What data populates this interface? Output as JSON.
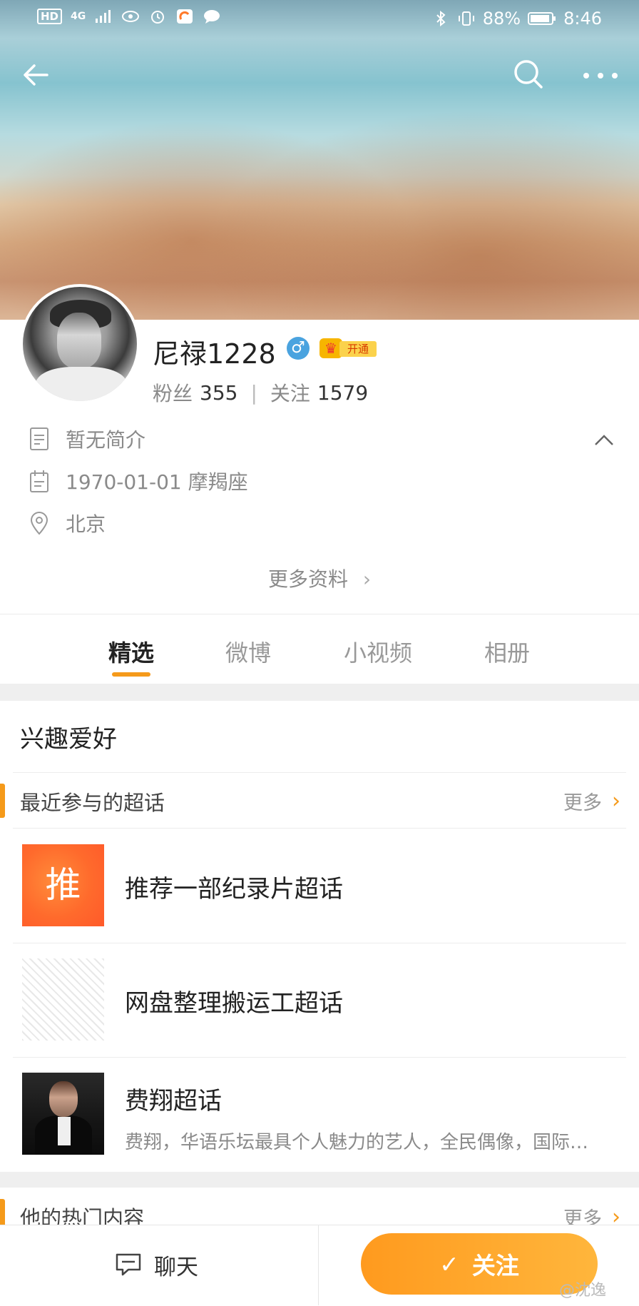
{
  "status_bar": {
    "left": [
      "HD",
      "4G"
    ],
    "battery": "88%",
    "time": "8:46"
  },
  "profile": {
    "name": "尼禄1228",
    "gender_symbol": "♂",
    "vip_tag": "开通",
    "followers_label": "粉丝",
    "followers_count": "355",
    "separator": "|",
    "following_label": "关注",
    "following_count": "1579"
  },
  "info": {
    "bio": "暂无简介",
    "birthday": "1970-01-01 摩羯座",
    "location": "北京",
    "more_label": "更多资料",
    "more_chevron": "›"
  },
  "tabs": [
    {
      "label": "精选",
      "active": true
    },
    {
      "label": "微博",
      "active": false
    },
    {
      "label": "小视频",
      "active": false
    },
    {
      "label": "相册",
      "active": false
    }
  ],
  "interests": {
    "title": "兴趣爱好",
    "recent_topics_label": "最近参与的超话",
    "more_label": "更多",
    "chevron": "›",
    "topics": [
      {
        "thumb_text": "推",
        "name": "推荐一部纪录片超话",
        "desc": ""
      },
      {
        "thumb_text": "",
        "name": "网盘整理搬运工超话",
        "desc": ""
      },
      {
        "thumb_text": "",
        "name": "费翔超话",
        "desc": "费翔，华语乐坛最具个人魅力的艺人，全民偶像，国际…"
      }
    ]
  },
  "hot": {
    "title": "他的热门内容",
    "more_label": "更多",
    "chevron": "›"
  },
  "bottom_bar": {
    "chat_label": "聊天",
    "follow_label": "关注",
    "follow_check": "✓"
  },
  "watermark": "@沈逸",
  "colors": {
    "accent": "#f59a1a",
    "follow_gradient_start": "#ff9a1e",
    "follow_gradient_end": "#ffb63c",
    "gender": "#4aa3df"
  },
  "icons": [
    "back-arrow-icon",
    "search-icon",
    "more-dots-icon",
    "document-icon",
    "calendar-icon",
    "location-pin-icon",
    "chevron-up-icon",
    "chat-bubble-icon",
    "check-icon"
  ]
}
